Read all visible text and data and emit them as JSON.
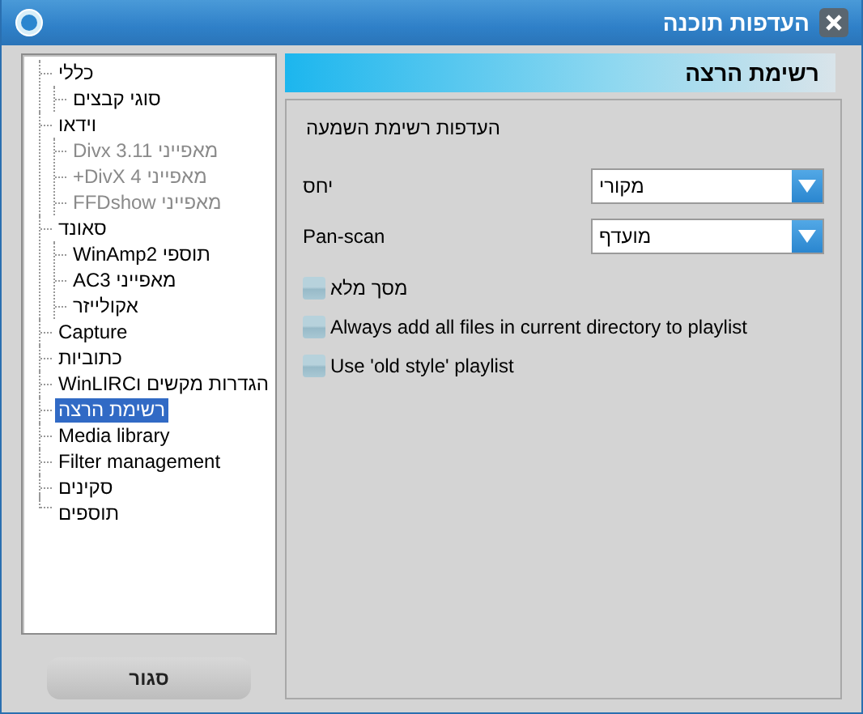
{
  "window": {
    "title": "העדפות תוכנה"
  },
  "tree": [
    {
      "label": "כללי",
      "selected": false,
      "disabled": false,
      "children": [
        {
          "label": "סוגי קבצים",
          "selected": false,
          "disabled": false
        }
      ]
    },
    {
      "label": "וידאו",
      "selected": false,
      "disabled": false,
      "children": [
        {
          "label": "מאפייני Divx 3.11",
          "selected": false,
          "disabled": true
        },
        {
          "label": "מאפייני DivX 4+",
          "selected": false,
          "disabled": true
        },
        {
          "label": "מאפייני FFDshow",
          "selected": false,
          "disabled": true
        }
      ]
    },
    {
      "label": "סאונד",
      "selected": false,
      "disabled": false,
      "children": [
        {
          "label": "תוספי WinAmp2",
          "selected": false,
          "disabled": false
        },
        {
          "label": "מאפייני AC3",
          "selected": false,
          "disabled": false
        },
        {
          "label": "אקולייזר",
          "selected": false,
          "disabled": false
        }
      ]
    },
    {
      "label": "Capture",
      "selected": false,
      "disabled": false
    },
    {
      "label": "כתוביות",
      "selected": false,
      "disabled": false
    },
    {
      "label": "הגדרות מקשים וWinLIRC",
      "selected": false,
      "disabled": false
    },
    {
      "label": "רשימת הרצה",
      "selected": true,
      "disabled": false
    },
    {
      "label": "Media library",
      "selected": false,
      "disabled": false
    },
    {
      "label": "Filter management",
      "selected": false,
      "disabled": false
    },
    {
      "label": "סקינים",
      "selected": false,
      "disabled": false
    },
    {
      "label": "תוספים",
      "selected": false,
      "disabled": false
    }
  ],
  "close_button": "סגור",
  "panel": {
    "title": "רשימת הרצה",
    "section_title": "העדפות רשימת השמעה",
    "dropdowns": [
      {
        "label": "יחס",
        "value": "מקורי"
      },
      {
        "label": "Pan-scan",
        "value": "מועדף"
      }
    ],
    "checkboxes": [
      {
        "label": "מסך מלא",
        "checked": false
      },
      {
        "label": "Always add all files in current directory to playlist",
        "checked": false
      },
      {
        "label": "Use 'old style' playlist",
        "checked": false
      }
    ]
  }
}
